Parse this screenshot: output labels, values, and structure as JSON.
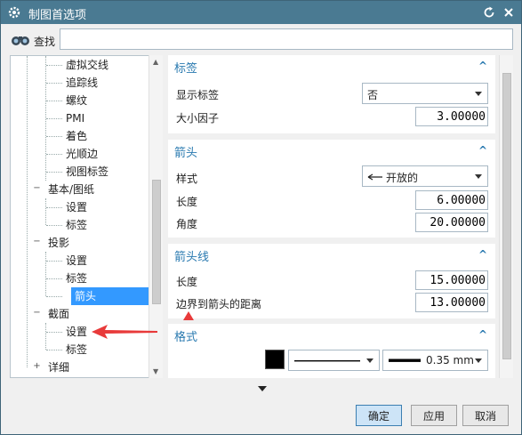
{
  "window": {
    "title": "制图首选项"
  },
  "search": {
    "label": "查找",
    "value": ""
  },
  "tree": {
    "items": [
      {
        "label": "虚拟交线"
      },
      {
        "label": "追踪线"
      },
      {
        "label": "螺纹"
      },
      {
        "label": "PMI"
      },
      {
        "label": "着色"
      },
      {
        "label": "光顺边"
      },
      {
        "label": "视图标签"
      },
      {
        "label": "基本/图纸"
      },
      {
        "label": "设置"
      },
      {
        "label": "标签"
      },
      {
        "label": "投影"
      },
      {
        "label": "设置"
      },
      {
        "label": "标签"
      },
      {
        "label": "箭头"
      },
      {
        "label": "截面"
      },
      {
        "label": "设置"
      },
      {
        "label": "标签"
      },
      {
        "label": "详细"
      }
    ],
    "expanders": {
      "collapsed": "−",
      "expanded": "+"
    },
    "selected_index": 13
  },
  "sections": {
    "label": {
      "title": "标签",
      "show_label": "显示标签",
      "show_label_value": "否",
      "size_factor": "大小因子",
      "size_factor_value": "3.00000"
    },
    "arrow": {
      "title": "箭头",
      "style": "样式",
      "style_value": "开放的",
      "length": "长度",
      "length_value": "6.00000",
      "angle": "角度",
      "angle_value": "20.00000"
    },
    "arrow_line": {
      "title": "箭头线",
      "length": "长度",
      "length_value": "15.00000",
      "distance": "边界到箭头的距离",
      "distance_value": "13.00000"
    },
    "format": {
      "title": "格式",
      "color": "#000000",
      "width_value": "0.35 mm"
    }
  },
  "buttons": {
    "ok": "确定",
    "apply": "应用",
    "cancel": "取消"
  },
  "colors": {
    "titlebar": "#4a7a92",
    "accent": "#2a7ab0",
    "selected": "#3399ff",
    "annotation": "#e83a3a"
  }
}
